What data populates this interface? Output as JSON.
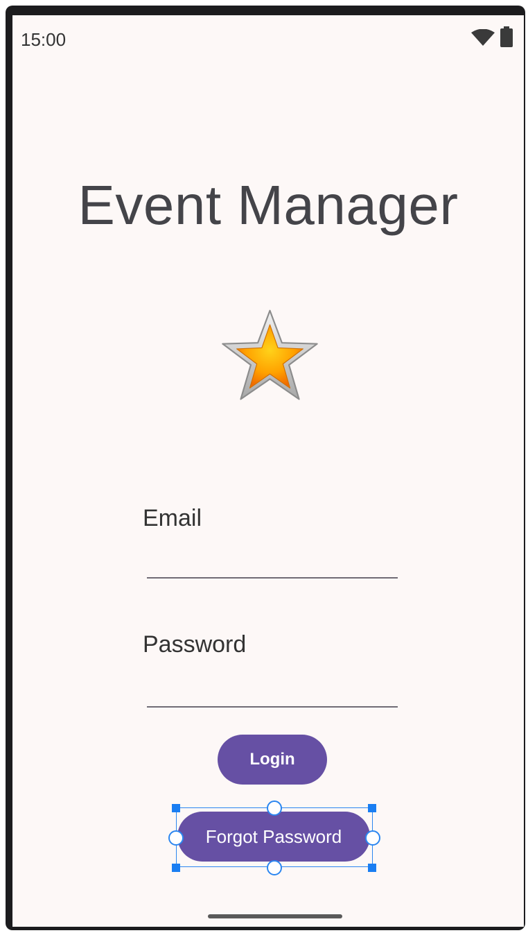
{
  "status_bar": {
    "time": "15:00",
    "icons": [
      "wifi-icon",
      "battery-icon"
    ]
  },
  "app": {
    "title": "Event Manager",
    "logo_icon": "star-icon"
  },
  "form": {
    "email_label": "Email",
    "email_value": "",
    "password_label": "Password",
    "password_value": ""
  },
  "buttons": {
    "login_label": "Login",
    "forgot_password_label": "Forgot Password"
  },
  "colors": {
    "primary": "#6650a4",
    "background": "#fdf8f7",
    "selection": "#2b86f0"
  }
}
